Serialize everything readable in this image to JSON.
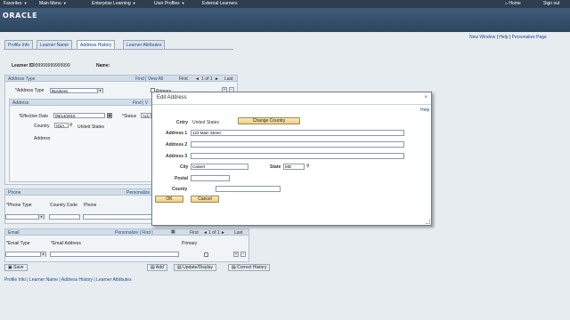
{
  "topnav": {
    "favorites": "Favorites",
    "main_menu": "Main Menu",
    "enterprise_learning": "Enterprise Learning",
    "user_profiles": "User Profiles",
    "external_learners": "External Learners",
    "home": "Home",
    "sign_out": "Sign out",
    "arrow": "▼"
  },
  "brand": {
    "logo": "ORACLE"
  },
  "page_links": {
    "new_window": "New Window",
    "help": "Help",
    "personalize": "Personalize Page"
  },
  "tabs": [
    "Profile Info",
    "Learner Name",
    "Address History",
    "Learner Attributes"
  ],
  "learner": {
    "id_label": "Learner ID",
    "id_value": "999999999999999",
    "name_label": "Name:"
  },
  "address_type_section": {
    "title": "Address Type",
    "nav": "Find | View All",
    "first": "First",
    "count": "1 of 1",
    "last": "Last",
    "type_label": "*Address Type",
    "type_value": "Business",
    "primary_label": "Primary"
  },
  "address_section": {
    "title": "Address",
    "nav": "Find | V",
    "eff_date_label": "*Effective Date",
    "eff_date_value": "09/14/2015",
    "status_label": "*Status",
    "status_value": "Acti",
    "country_label": "Country",
    "country_value": "USA",
    "country_desc": "United States",
    "address_label": "Address"
  },
  "phone_section": {
    "title": "Phone",
    "nav": "Personalize",
    "col_type": "*Phone Type",
    "col_country": "Country Code",
    "col_phone": "Phone"
  },
  "email_section": {
    "title": "Email",
    "nav": "Personalize | Find |",
    "first": "First",
    "count": "1 of 1",
    "last": "Last",
    "col_type": "*Email Type",
    "col_address": "*Email Address",
    "col_primary": "Primary"
  },
  "actions": {
    "save": "Save",
    "add": "Add",
    "update_display": "Update/Display",
    "correct_history": "Correct History"
  },
  "footer_links": "Profile Info | Learner Name | Address History | Learner Attributes",
  "modal": {
    "title": "Edit Address",
    "close": "×",
    "help": "Help",
    "cntry_label": "Cntry",
    "cntry_value": "United States",
    "change_country": "Change Country",
    "address1_label": "Address 1",
    "address1_value": "123 Main Street",
    "address2_label": "Address 2",
    "address2_value": "",
    "address3_label": "Address 3",
    "address3_value": "",
    "city_label": "City",
    "city_value": "Calvert",
    "state_label": "State",
    "state_value": "MD",
    "postal_label": "Postal",
    "postal_value": "",
    "county_label": "County",
    "county_value": "",
    "ok": "OK",
    "cancel": "Cancel"
  }
}
